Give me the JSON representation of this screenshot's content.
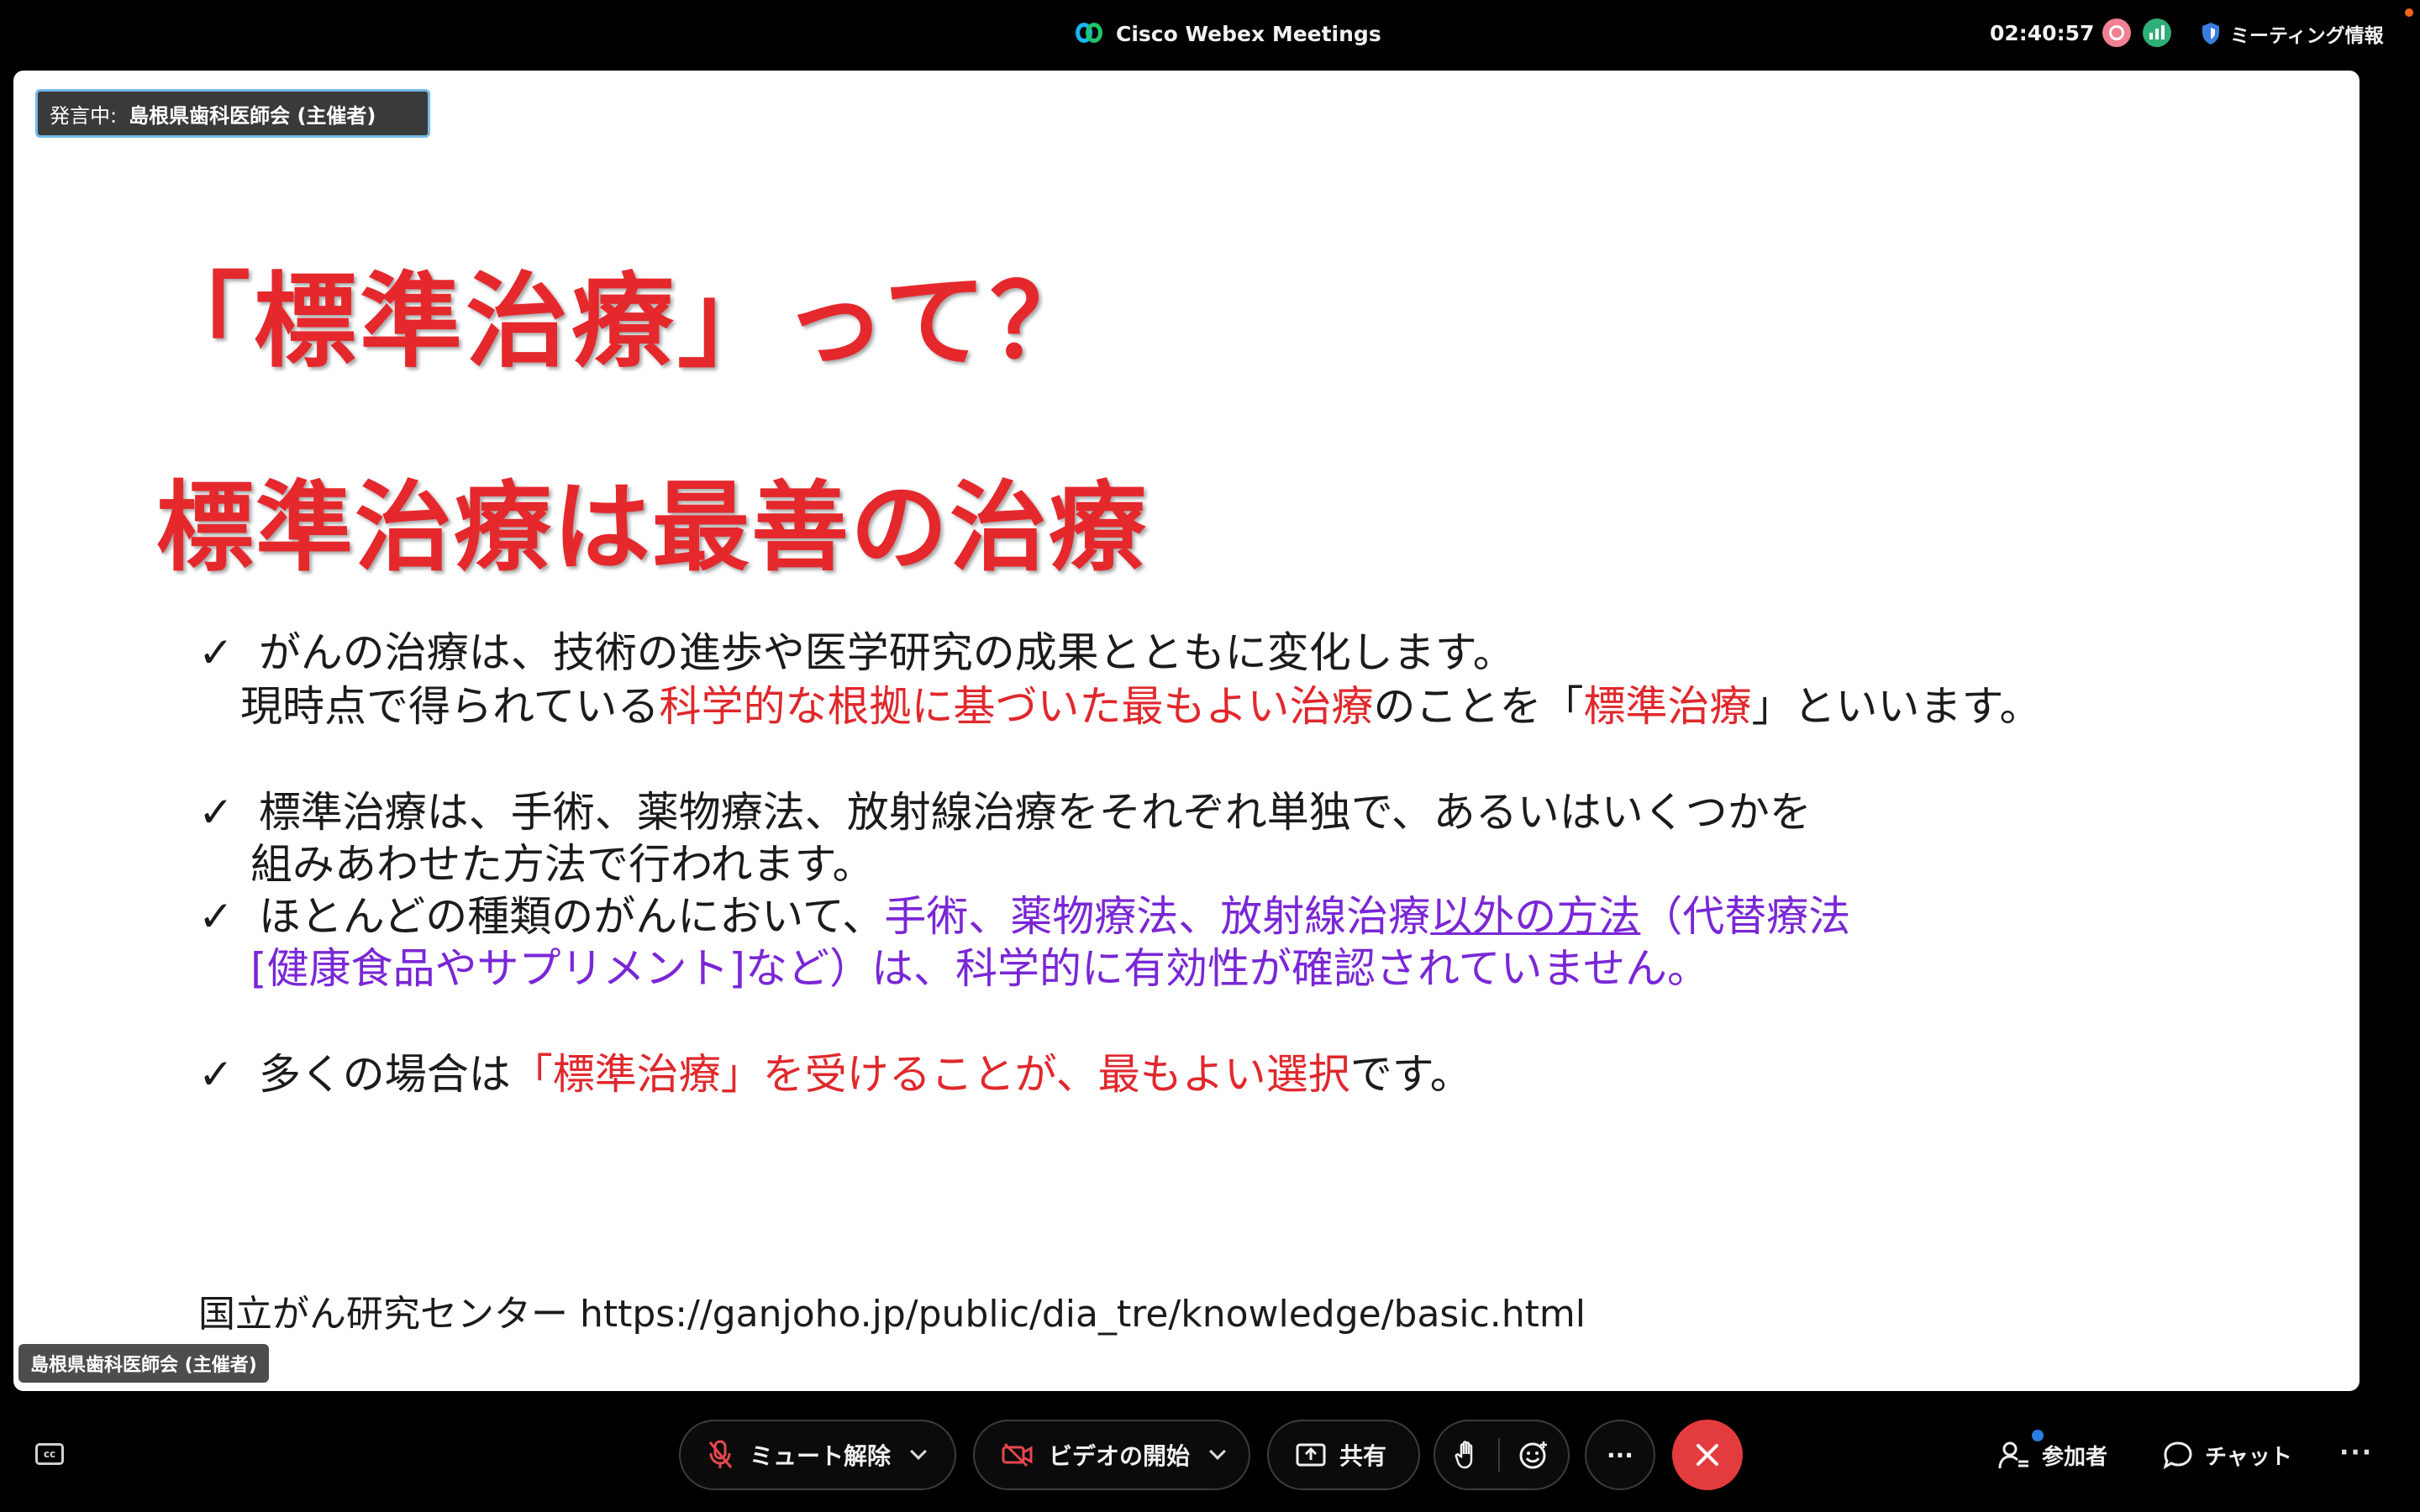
{
  "topbar": {
    "app_title": "Cisco Webex Meetings",
    "clock": "02:40:57",
    "meeting_info_label": "ミーティング情報",
    "colors": {
      "recording": "#ef8193",
      "stats": "#2fae78",
      "notify": "#f7641b"
    }
  },
  "stage": {
    "speaking_prefix": "発言中:",
    "speaking_name": "島根県歯科医師会 (主催者)",
    "name_tag": "島根県歯科医師会 (主催者)"
  },
  "slide": {
    "title": "「標準治療」って？",
    "subtitle": "標準治療は最善の治療",
    "bullet1": {
      "line1": "がんの治療は、技術の進歩や医学研究の成果とともに変化します。",
      "line2_a": "現時点で得られている",
      "line2_b": "科学的な根拠に基づいた最もよい治療",
      "line2_c": "のことを「",
      "line2_d": "標準治療",
      "line2_e": "」といいます。"
    },
    "bullet2": {
      "line1": "標準治療は、手術、薬物療法、放射線治療をそれぞれ単独で、あるいはいくつかを",
      "line2": "組みあわせた方法で行われます。"
    },
    "bullet3": {
      "line1_a": "ほとんどの種類のがんにおいて、",
      "line1_b": "手術、薬物療法、放射線治療",
      "line1_c": "以外の方法",
      "line1_d": "（代替療法",
      "line2": "[健康食品やサプリメント]など）は、科学的に有効性が確認されていません。"
    },
    "bullet4": {
      "a": "多くの場合は",
      "b": "「標準治療」を受けることが、最もよい選択",
      "c": "です。"
    },
    "check_mark": "✓",
    "source": "国立がん研究センター https://ganjoho.jp/public/dia_tre/knowledge/basic.html",
    "colors": {
      "title_red": "#e5282c",
      "highlight_red": "#e0282c",
      "highlight_purple": "#7a27d6"
    }
  },
  "controls": {
    "cc_label": "cc",
    "unmute_label": "ミュート解除",
    "video_label": "ビデオの開始",
    "share_label": "共有",
    "more_label": "···",
    "participants_label": "参加者",
    "chat_label": "チャット",
    "more_right_label": "···",
    "colors": {
      "end": "#e43b3f",
      "participants_dot": "#2a7de1"
    }
  }
}
